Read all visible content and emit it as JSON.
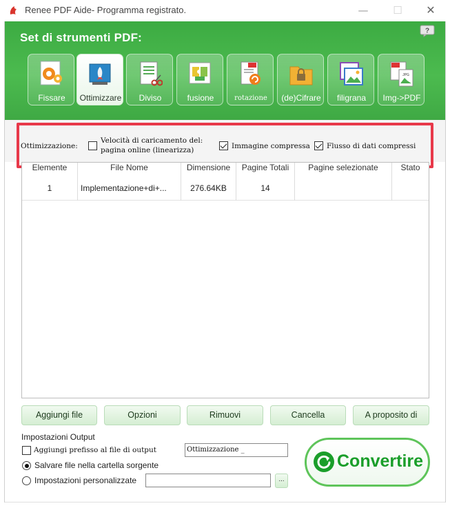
{
  "window": {
    "title": "Renee PDF Aide- Programma registrato.",
    "minimize_glyph": "—",
    "maximize_glyph": "☐",
    "close_glyph": "✕"
  },
  "header": {
    "title": "Set di strumenti PDF:",
    "help_icon": "question-bubble-icon",
    "tools": [
      {
        "label": "Fissare",
        "icon": "wrench-gear-icon"
      },
      {
        "label": "Ottimizzare",
        "icon": "rocket-monitor-icon"
      },
      {
        "label": "Diviso",
        "icon": "document-scissors-icon"
      },
      {
        "label": "fusione",
        "icon": "puzzle-icon"
      },
      {
        "label": "rotazione",
        "icon": "pdf-rotate-icon"
      },
      {
        "label": "(de)Cifrare",
        "icon": "folder-lock-icon"
      },
      {
        "label": "filigrana",
        "icon": "image-watermark-icon"
      },
      {
        "label": "Img->PDF",
        "icon": "jpg-to-pdf-icon"
      }
    ],
    "active_tool": "Ottimizzare"
  },
  "options": {
    "label": "Ottimizzazione:",
    "linearize_line1": "Velocità di caricamento del:",
    "linearize_line2": "pagina online (linearizza)",
    "linearize_checked": false,
    "compress_images": "Immagine compressa",
    "compress_images_checked": true,
    "compress_flow": "Flusso di dati compressi",
    "compress_flow_checked": true,
    "highlight_color": "#e8394a"
  },
  "table": {
    "columns": [
      "Elemente",
      "File Nome",
      "Dimensione",
      "Pagine Totali",
      "Pagine selezionate",
      "Stato"
    ],
    "rows": [
      {
        "element": "1",
        "file": "Implementazione+di+...",
        "size": "276.64KB",
        "pages": "14",
        "selected": "",
        "status": ""
      }
    ]
  },
  "buttons": {
    "add": "Aggiungi file",
    "options": "Opzioni",
    "remove": "Rimuovi",
    "clear": "Cancella",
    "about": "A proposito di"
  },
  "output": {
    "title": "Impostazioni Output",
    "prefix_label": "Aggiungi prefisso al file di output",
    "prefix_checked": false,
    "prefix_value": "Ottimizzazione _",
    "save_source": "Salvare file nella cartella sorgente",
    "save_source_selected": true,
    "custom": "Impostazioni personalizzate",
    "custom_selected": false,
    "custom_path": "",
    "browse": "..."
  },
  "convert": {
    "label": "Convertire",
    "color": "#1a9e2a"
  }
}
